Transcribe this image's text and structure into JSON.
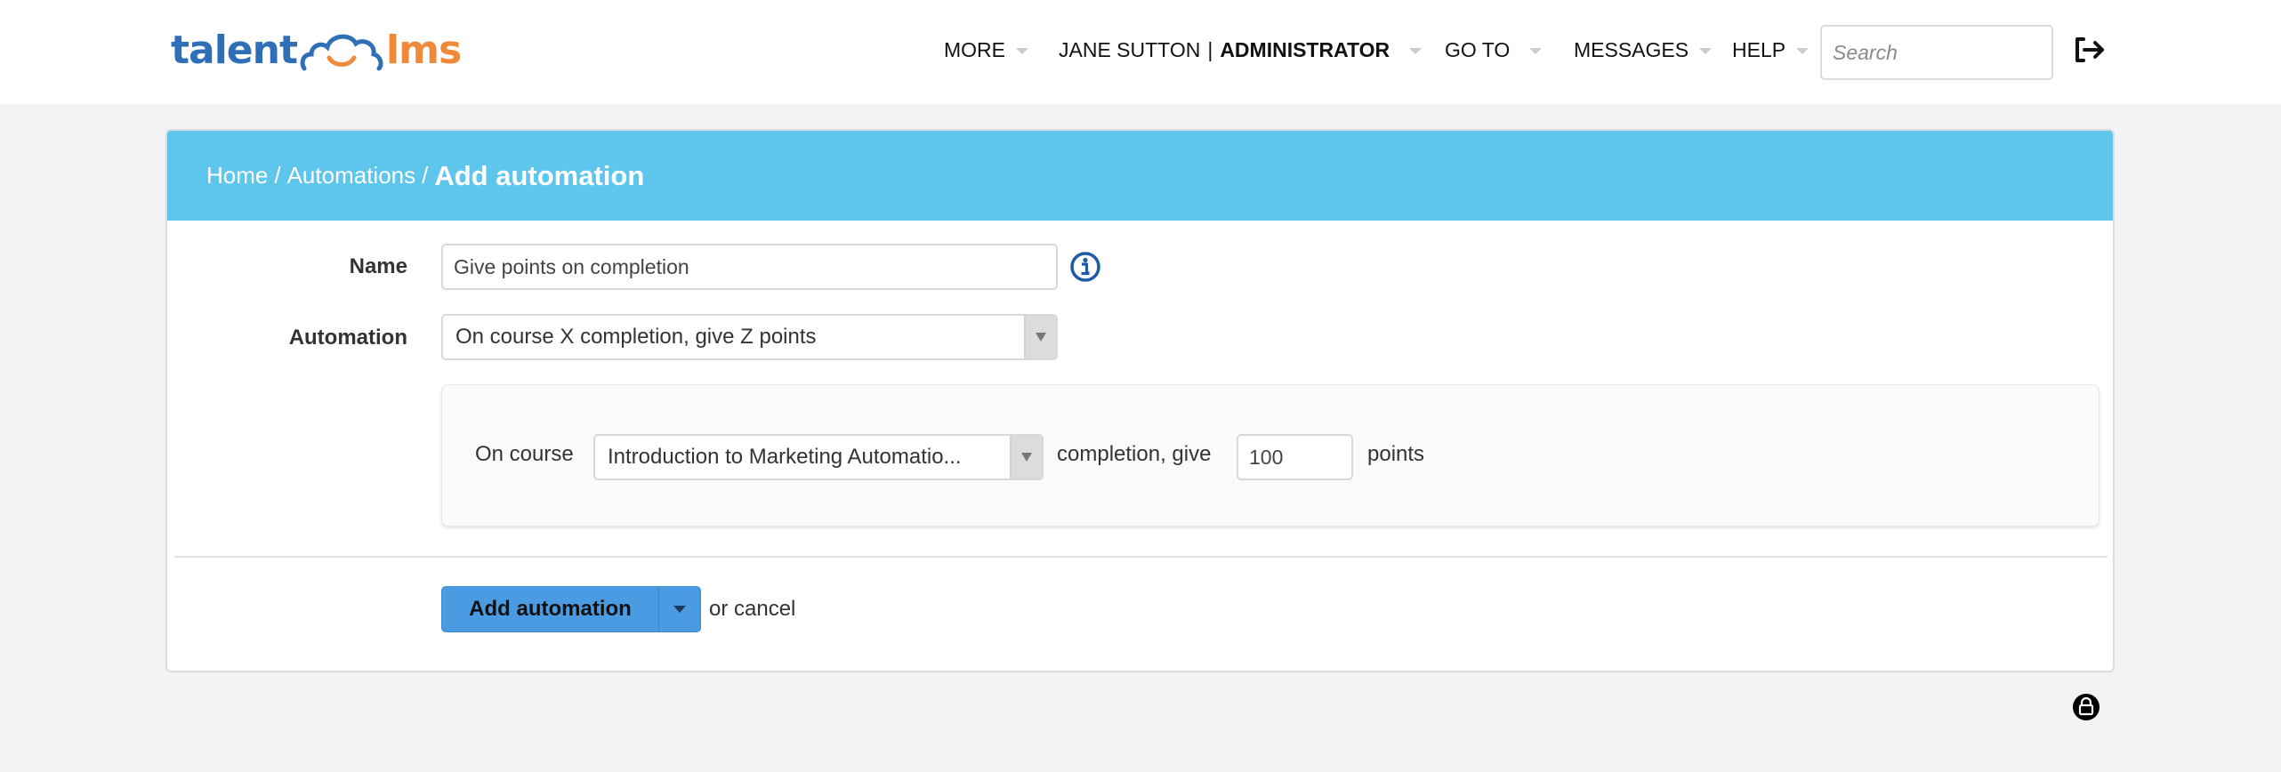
{
  "brand": {
    "logo_left": "talent",
    "logo_right": "lms",
    "colors": {
      "blue": "#2f6fb7",
      "orange": "#ef8a3a",
      "header": "#5ec5ed",
      "button": "#4a9be1"
    }
  },
  "topnav": {
    "more": "MORE",
    "user_name": "JANE SUTTON",
    "user_sep": "|",
    "user_role": "ADMINISTRATOR",
    "goto": "GO TO",
    "messages": "MESSAGES",
    "help": "HELP",
    "search_placeholder": "Search",
    "search_value": "",
    "logout_icon": "logout-icon"
  },
  "breadcrumb": {
    "home": "Home",
    "sep": "/",
    "automations": "Automations",
    "current": "Add automation"
  },
  "form": {
    "name_label": "Name",
    "name_value": "Give points on completion",
    "name_info_icon": "info-icon",
    "automation_label": "Automation",
    "automation_selected": "On course X completion, give Z points",
    "rule": {
      "prefix": "On course",
      "course_selected": "Introduction to Marketing Automatio...",
      "middle": "completion, give",
      "points_value": "100",
      "suffix": "points"
    }
  },
  "actions": {
    "submit_label": "Add automation",
    "or_text": "or",
    "cancel_label": "cancel"
  },
  "footer": {
    "lock_icon": "lock-icon"
  }
}
